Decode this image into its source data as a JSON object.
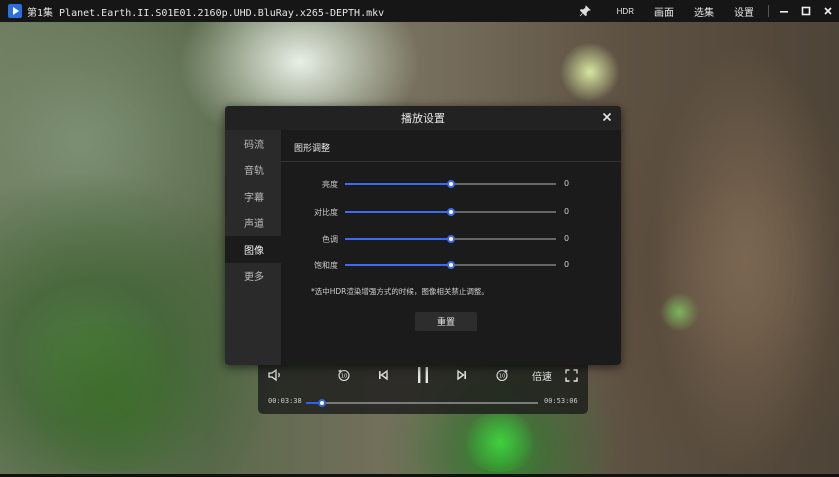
{
  "titlebar": {
    "file_title": "第1集 Planet.Earth.II.S01E01.2160p.UHD.BluRay.x265-DEPTH.mkv",
    "menu": {
      "hdr": "HDR",
      "picture": "画面",
      "episodes": "选集",
      "settings": "设置"
    },
    "icons": {
      "logo": "play-logo-icon",
      "pin": "pin-icon",
      "minimize": "minimize-icon",
      "maximize": "maximize-icon",
      "close": "close-icon"
    }
  },
  "dialog": {
    "title": "播放设置",
    "sidebar": [
      {
        "label": "码流",
        "active": false
      },
      {
        "label": "音轨",
        "active": false
      },
      {
        "label": "字幕",
        "active": false
      },
      {
        "label": "声道",
        "active": false
      },
      {
        "label": "图像",
        "active": true
      },
      {
        "label": "更多",
        "active": false
      }
    ],
    "section_title": "图形调整",
    "sliders": [
      {
        "label": "亮度",
        "value": "0",
        "level": 0.5
      },
      {
        "label": "对比度",
        "value": "0",
        "level": 0.5
      },
      {
        "label": "色调",
        "value": "0",
        "level": 0.5
      },
      {
        "label": "饱和度",
        "value": "0",
        "level": 0.5
      }
    ],
    "note": "*选中HDR渲染增强方式的时候，图像相关禁止调整。",
    "reset_label": "重置"
  },
  "player": {
    "current_time": "00:03:38",
    "total_time": "00:53:06",
    "progress": 0.068,
    "speed_label": "倍速",
    "accent_color": "#2d63e6",
    "icons": [
      "volume-icon",
      "rewind-10-icon",
      "previous-icon",
      "pause-icon",
      "next-icon",
      "forward-10-icon",
      "fullscreen-icon"
    ]
  }
}
